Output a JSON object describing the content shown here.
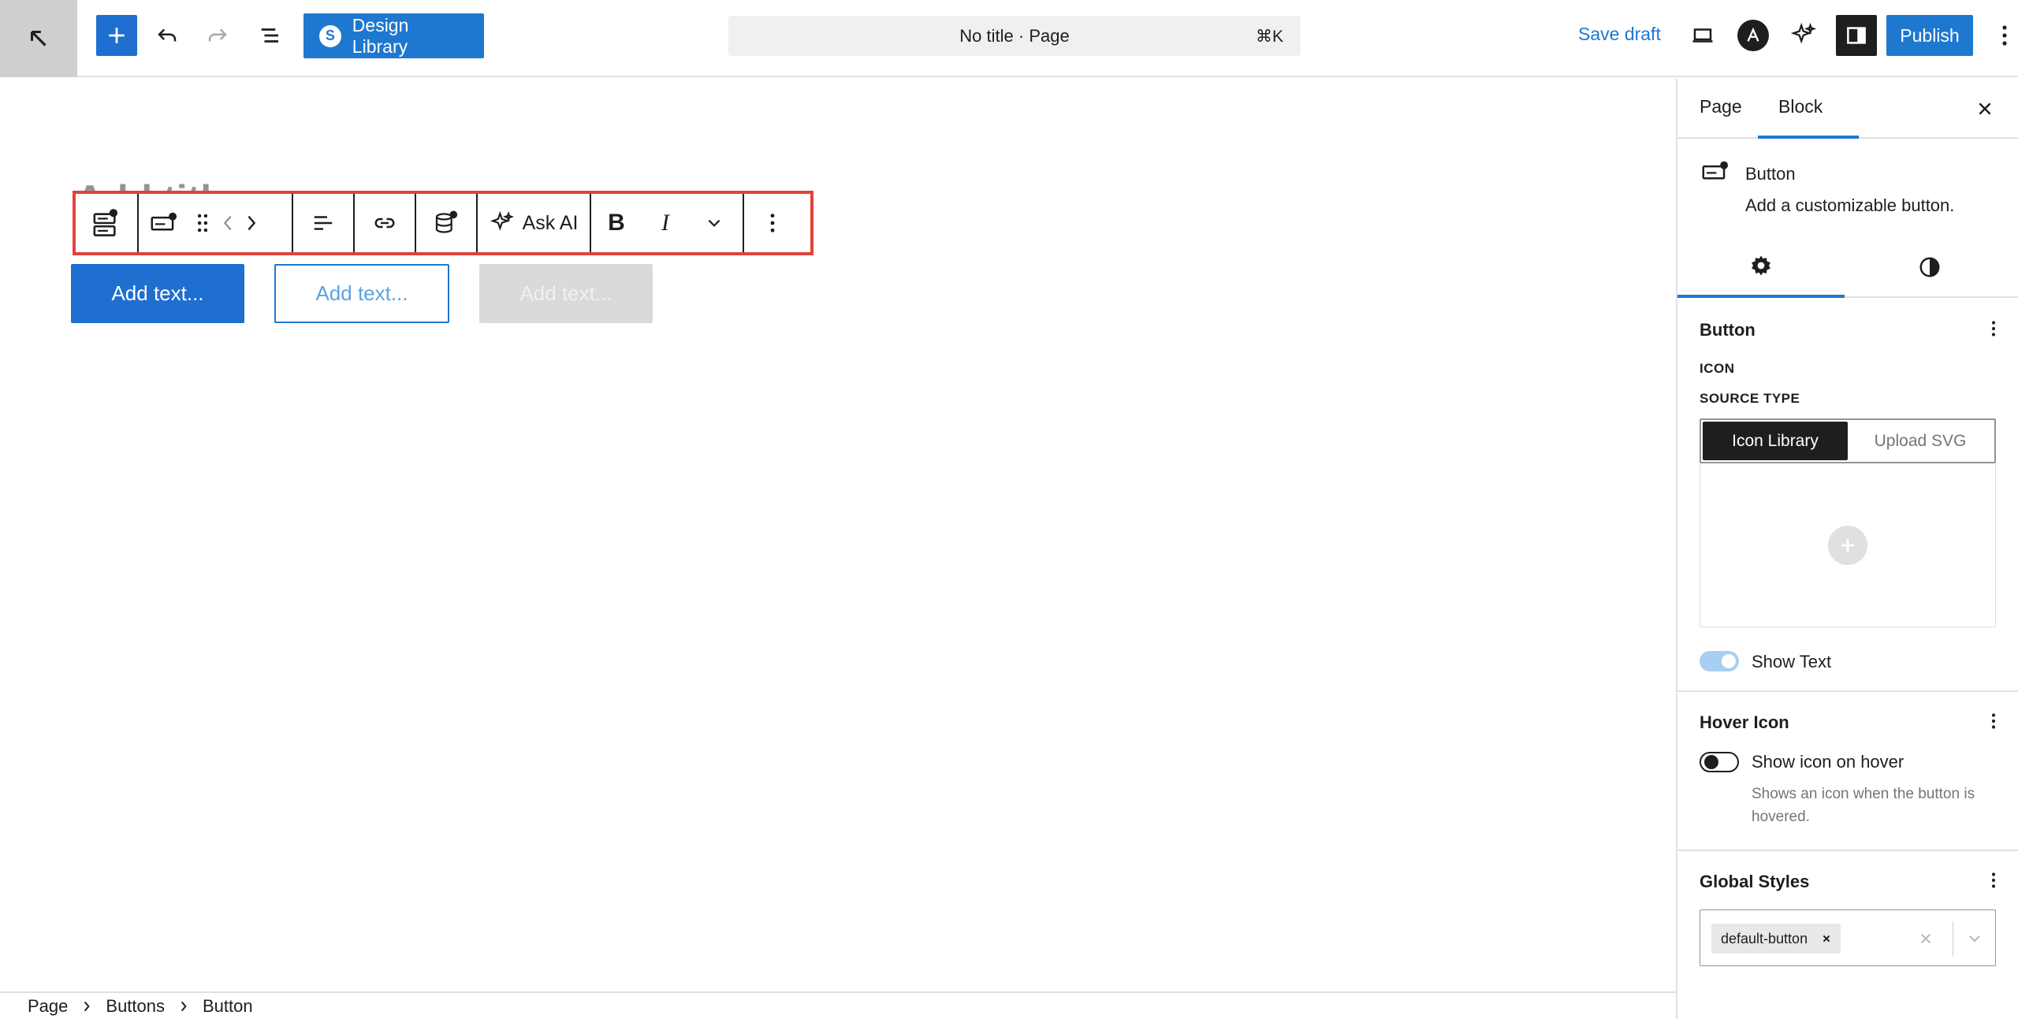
{
  "topbar": {
    "design_library_label": "Design Library",
    "design_library_logo": "S",
    "command_bar_text": "No title · Page",
    "command_bar_shortcut": "⌘K",
    "save_draft_label": "Save draft",
    "publish_label": "Publish"
  },
  "editor": {
    "title_placeholder": "Add title",
    "toolbar": {
      "ask_ai_label": "Ask AI",
      "bold_label": "B",
      "italic_label": "I"
    },
    "buttons": [
      {
        "label": "Add text..."
      },
      {
        "label": "Add text..."
      },
      {
        "label": "Add text..."
      }
    ]
  },
  "breadcrumb": {
    "items": [
      "Page",
      "Buttons",
      "Button"
    ]
  },
  "sidebar": {
    "tabs": [
      "Page",
      "Block"
    ],
    "active_tab": "Block",
    "block": {
      "name": "Button",
      "description": "Add a customizable button."
    },
    "sections": {
      "button": {
        "title": "Button",
        "icon_label": "ICON",
        "source_type_label": "SOURCE TYPE",
        "source_options": [
          "Icon Library",
          "Upload SVG"
        ],
        "show_text_label": "Show Text",
        "show_text_enabled": true
      },
      "hover_icon": {
        "title": "Hover Icon",
        "toggle_label": "Show icon on hover",
        "toggle_enabled": false,
        "help": "Shows an icon when the button is hovered."
      },
      "global_styles": {
        "title": "Global Styles",
        "chip": "default-button"
      }
    }
  },
  "colors": {
    "accent": "#1e78cf",
    "highlight": "#e0433b"
  }
}
